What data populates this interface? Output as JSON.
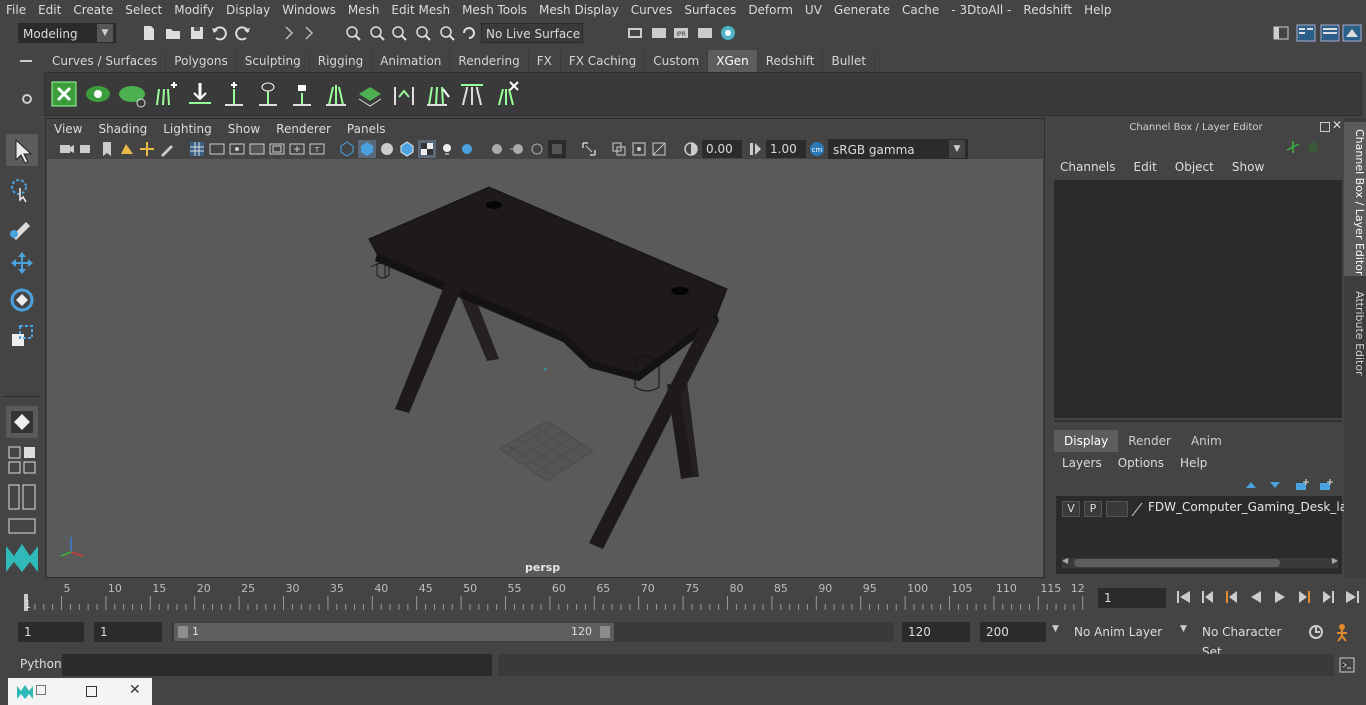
{
  "menus": [
    "File",
    "Edit",
    "Create",
    "Select",
    "Modify",
    "Display",
    "Windows",
    "Mesh",
    "Edit Mesh",
    "Mesh Tools",
    "Mesh Display",
    "Curves",
    "Surfaces",
    "Deform",
    "UV",
    "Generate",
    "Cache",
    "- 3DtoAll -",
    "Redshift",
    "Help"
  ],
  "status": {
    "mode": "Modeling",
    "live_surface": "No Live Surface"
  },
  "shelf_tabs": [
    "Curves / Surfaces",
    "Polygons",
    "Sculpting",
    "Rigging",
    "Animation",
    "Rendering",
    "FX",
    "FX Caching",
    "Custom",
    "XGen",
    "Redshift",
    "Bullet"
  ],
  "shelf_active": "XGen",
  "viewport": {
    "menus": [
      "View",
      "Shading",
      "Lighting",
      "Show",
      "Renderer",
      "Panels"
    ],
    "exposure": "0.00",
    "gamma": "1.00",
    "color_space": "sRGB gamma",
    "camera_label": "persp"
  },
  "channel_box": {
    "title": "Channel Box / Layer Editor",
    "menus": [
      "Channels",
      "Edit",
      "Object",
      "Show"
    ],
    "layer_tabs": [
      "Display",
      "Render",
      "Anim"
    ],
    "layer_tab_active": "Display",
    "layer_menus": [
      "Layers",
      "Options",
      "Help"
    ],
    "layer": {
      "v": "V",
      "p": "P",
      "name": "FDW_Computer_Gaming_Desk_layer"
    }
  },
  "side_tabs": [
    "Channel Box / Layer Editor",
    "Attribute Editor"
  ],
  "timeline": {
    "ticks": [
      "5",
      "10",
      "15",
      "20",
      "25",
      "30",
      "35",
      "40",
      "45",
      "50",
      "55",
      "60",
      "65",
      "70",
      "75",
      "80",
      "85",
      "90",
      "95",
      "100",
      "105",
      "110",
      "115",
      "12"
    ],
    "start_mark": "1",
    "current_frame": "1"
  },
  "range": {
    "start": "1",
    "anim_start": "1",
    "slider_start": "1",
    "slider_end": "120",
    "end": "120",
    "anim_end": "200",
    "anim_layer": "No Anim Layer",
    "character_set": "No Character Set"
  },
  "python_label": "Python",
  "colors": {
    "accent_xgen_green": "#4caf50",
    "active_tab": "#5d5d5d",
    "viewport_bg": "#5a5a5a",
    "desk": "#1e1a1c"
  }
}
